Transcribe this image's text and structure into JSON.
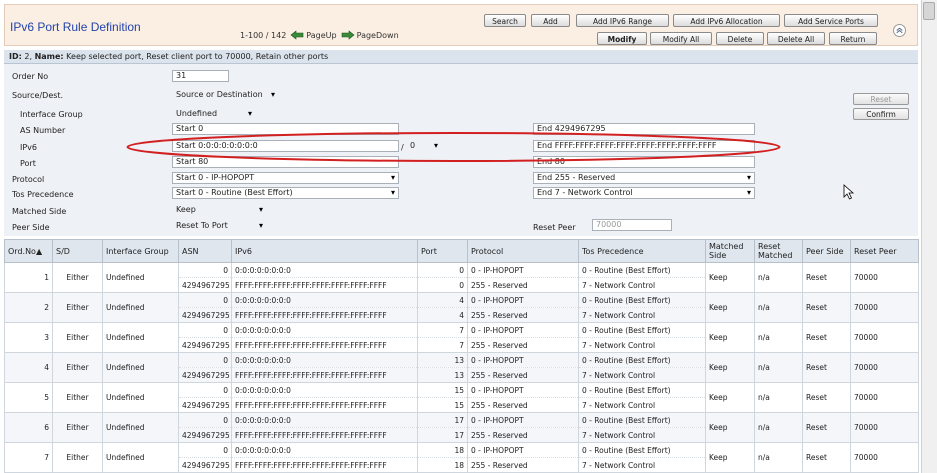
{
  "header": {
    "title": "IPv6 Port Rule Definition",
    "range": "1-100 / 142",
    "page_up": "PageUp",
    "page_down": "PageDown"
  },
  "toolbar": {
    "search": "Search",
    "add": "Add",
    "add_ipv6_range": "Add IPv6 Range",
    "add_ipv6_allocation": "Add IPv6 Allocation",
    "add_service_ports": "Add Service Ports",
    "modify": "Modify",
    "modify_all": "Modify All",
    "delete": "Delete",
    "delete_all": "Delete All",
    "return": "Return"
  },
  "idbar": {
    "id_label": "ID:",
    "id_value": "2,",
    "name_label": "Name:",
    "name_value": "Keep selected port, Reset client port to 70000, Retain other ports"
  },
  "form": {
    "order_no_label": "Order No",
    "order_no": "31",
    "source_dest_label": "Source/Dest.",
    "source_dest": "Source or Destination",
    "interface_group_label": "Interface Group",
    "interface_group": "Undefined",
    "as_number_label": "AS Number",
    "as_start": "Start 0",
    "as_end": "End 4294967295",
    "ipv6_label": "IPv6",
    "ipv6_start": "Start 0:0:0:0:0:0:0:0",
    "ipv6_slash": "/",
    "ipv6_prefix": "0",
    "ipv6_end": "End FFFF:FFFF:FFFF:FFFF:FFFF:FFFF:FFFF:FFFF",
    "port_label": "Port",
    "port_start": "Start 80",
    "port_end": "End 80",
    "protocol_label": "Protocol",
    "protocol_start": "Start 0 - IP-HOPOPT",
    "protocol_end": "End 255 - Reserved",
    "tos_label": "Tos Precedence",
    "tos_start": "Start 0 - Routine (Best Effort)",
    "tos_end": "End 7 - Network Control",
    "matched_side_label": "Matched Side",
    "matched_side": "Keep",
    "peer_side_label": "Peer Side",
    "peer_side": "Reset To Port",
    "reset_peer_label": "Reset Peer",
    "reset_peer_placeholder": "70000",
    "reset_button": "Reset",
    "confirm_button": "Confirm"
  },
  "table": {
    "headers": [
      "Ord.No▲",
      "S/D",
      "Interface Group",
      "ASN",
      "IPv6",
      "Port",
      "Protocol",
      "Tos Precedence",
      "Matched Side",
      "Reset Matched",
      "Peer Side",
      "Reset Peer"
    ],
    "rows": [
      {
        "ord": "1",
        "sd": "Either",
        "ig": "Undefined",
        "asn1": "0",
        "asn2": "4294967295",
        "ip1": "0:0:0:0:0:0:0:0",
        "ip2": "FFFF:FFFF:FFFF:FFFF:FFFF:FFFF:FFFF:FFFF",
        "port1": "0",
        "port2": "0",
        "proto1": "0 - IP-HOPOPT",
        "proto2": "255 - Reserved",
        "tos1": "0 - Routine (Best Effort)",
        "tos2": "7 - Network Control",
        "ms": "Keep",
        "rm": "n/a",
        "ps": "Reset",
        "rp": "70000"
      },
      {
        "ord": "2",
        "sd": "Either",
        "ig": "Undefined",
        "asn1": "0",
        "asn2": "4294967295",
        "ip1": "0:0:0:0:0:0:0:0",
        "ip2": "FFFF:FFFF:FFFF:FFFF:FFFF:FFFF:FFFF:FFFF",
        "port1": "4",
        "port2": "4",
        "proto1": "0 - IP-HOPOPT",
        "proto2": "255 - Reserved",
        "tos1": "0 - Routine (Best Effort)",
        "tos2": "7 - Network Control",
        "ms": "Keep",
        "rm": "n/a",
        "ps": "Reset",
        "rp": "70000"
      },
      {
        "ord": "3",
        "sd": "Either",
        "ig": "Undefined",
        "asn1": "0",
        "asn2": "4294967295",
        "ip1": "0:0:0:0:0:0:0:0",
        "ip2": "FFFF:FFFF:FFFF:FFFF:FFFF:FFFF:FFFF:FFFF",
        "port1": "7",
        "port2": "7",
        "proto1": "0 - IP-HOPOPT",
        "proto2": "255 - Reserved",
        "tos1": "0 - Routine (Best Effort)",
        "tos2": "7 - Network Control",
        "ms": "Keep",
        "rm": "n/a",
        "ps": "Reset",
        "rp": "70000"
      },
      {
        "ord": "4",
        "sd": "Either",
        "ig": "Undefined",
        "asn1": "0",
        "asn2": "4294967295",
        "ip1": "0:0:0:0:0:0:0:0",
        "ip2": "FFFF:FFFF:FFFF:FFFF:FFFF:FFFF:FFFF:FFFF",
        "port1": "13",
        "port2": "13",
        "proto1": "0 - IP-HOPOPT",
        "proto2": "255 - Reserved",
        "tos1": "0 - Routine (Best Effort)",
        "tos2": "7 - Network Control",
        "ms": "Keep",
        "rm": "n/a",
        "ps": "Reset",
        "rp": "70000"
      },
      {
        "ord": "5",
        "sd": "Either",
        "ig": "Undefined",
        "asn1": "0",
        "asn2": "4294967295",
        "ip1": "0:0:0:0:0:0:0:0",
        "ip2": "FFFF:FFFF:FFFF:FFFF:FFFF:FFFF:FFFF:FFFF",
        "port1": "15",
        "port2": "15",
        "proto1": "0 - IP-HOPOPT",
        "proto2": "255 - Reserved",
        "tos1": "0 - Routine (Best Effort)",
        "tos2": "7 - Network Control",
        "ms": "Keep",
        "rm": "n/a",
        "ps": "Reset",
        "rp": "70000"
      },
      {
        "ord": "6",
        "sd": "Either",
        "ig": "Undefined",
        "asn1": "0",
        "asn2": "4294967295",
        "ip1": "0:0:0:0:0:0:0:0",
        "ip2": "FFFF:FFFF:FFFF:FFFF:FFFF:FFFF:FFFF:FFFF",
        "port1": "17",
        "port2": "17",
        "proto1": "0 - IP-HOPOPT",
        "proto2": "255 - Reserved",
        "tos1": "0 - Routine (Best Effort)",
        "tos2": "7 - Network Control",
        "ms": "Keep",
        "rm": "n/a",
        "ps": "Reset",
        "rp": "70000"
      },
      {
        "ord": "7",
        "sd": "Either",
        "ig": "Undefined",
        "asn1": "0",
        "asn2": "4294967295",
        "ip1": "0:0:0:0:0:0:0:0",
        "ip2": "FFFF:FFFF:FFFF:FFFF:FFFF:FFFF:FFFF:FFFF",
        "port1": "18",
        "port2": "18",
        "proto1": "0 - IP-HOPOPT",
        "proto2": "255 - Reserved",
        "tos1": "0 - Routine (Best Effort)",
        "tos2": "7 - Network Control",
        "ms": "Keep",
        "rm": "n/a",
        "ps": "Reset",
        "rp": "70000"
      }
    ]
  },
  "colors": {
    "header_bg": "#fbeee3",
    "title": "#2244aa",
    "form_bg": "#eef1f5",
    "highlight_ellipse": "#d22020"
  }
}
